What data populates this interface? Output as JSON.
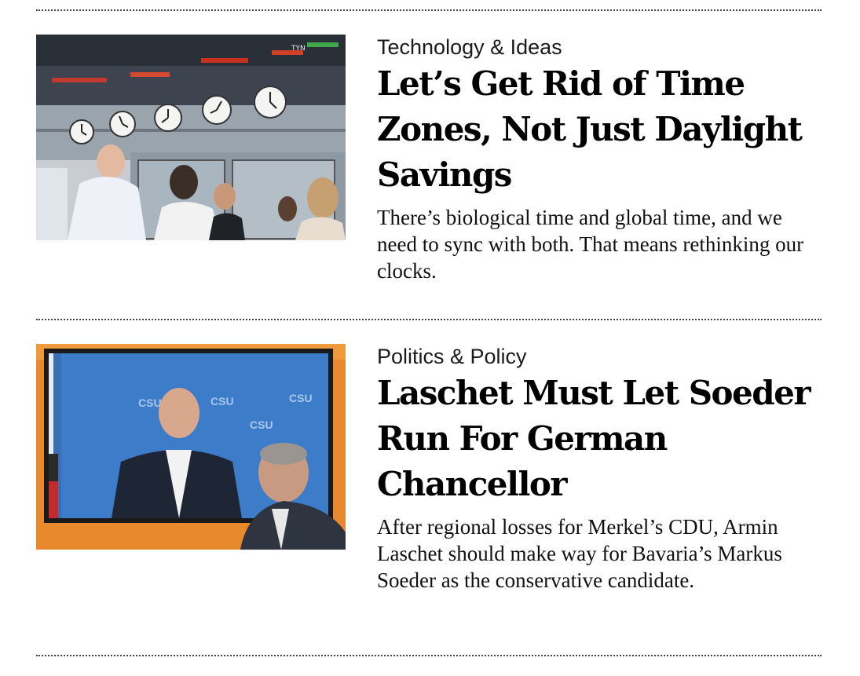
{
  "articles": [
    {
      "kicker": "Technology & Ideas",
      "headline": "Let’s Get Rid of Time Zones, Not Just Daylight Savings",
      "dek": "There’s biological time and global time, and we need to sync with both. That means rethinking our clocks.",
      "image_subject": "trading-floor-clocks"
    },
    {
      "kicker": "Politics & Policy",
      "headline": "Laschet Must Let Soeder Run For German Chancellor",
      "dek": "After regional losses for Merkel’s CDU, Armin Laschet should make way for Bavaria’s Markus Soeder as the conservative candidate.",
      "image_subject": "screen-press-conference"
    }
  ],
  "image_text": {
    "ticker_1": "TYN",
    "screen_logo": "CSU"
  }
}
